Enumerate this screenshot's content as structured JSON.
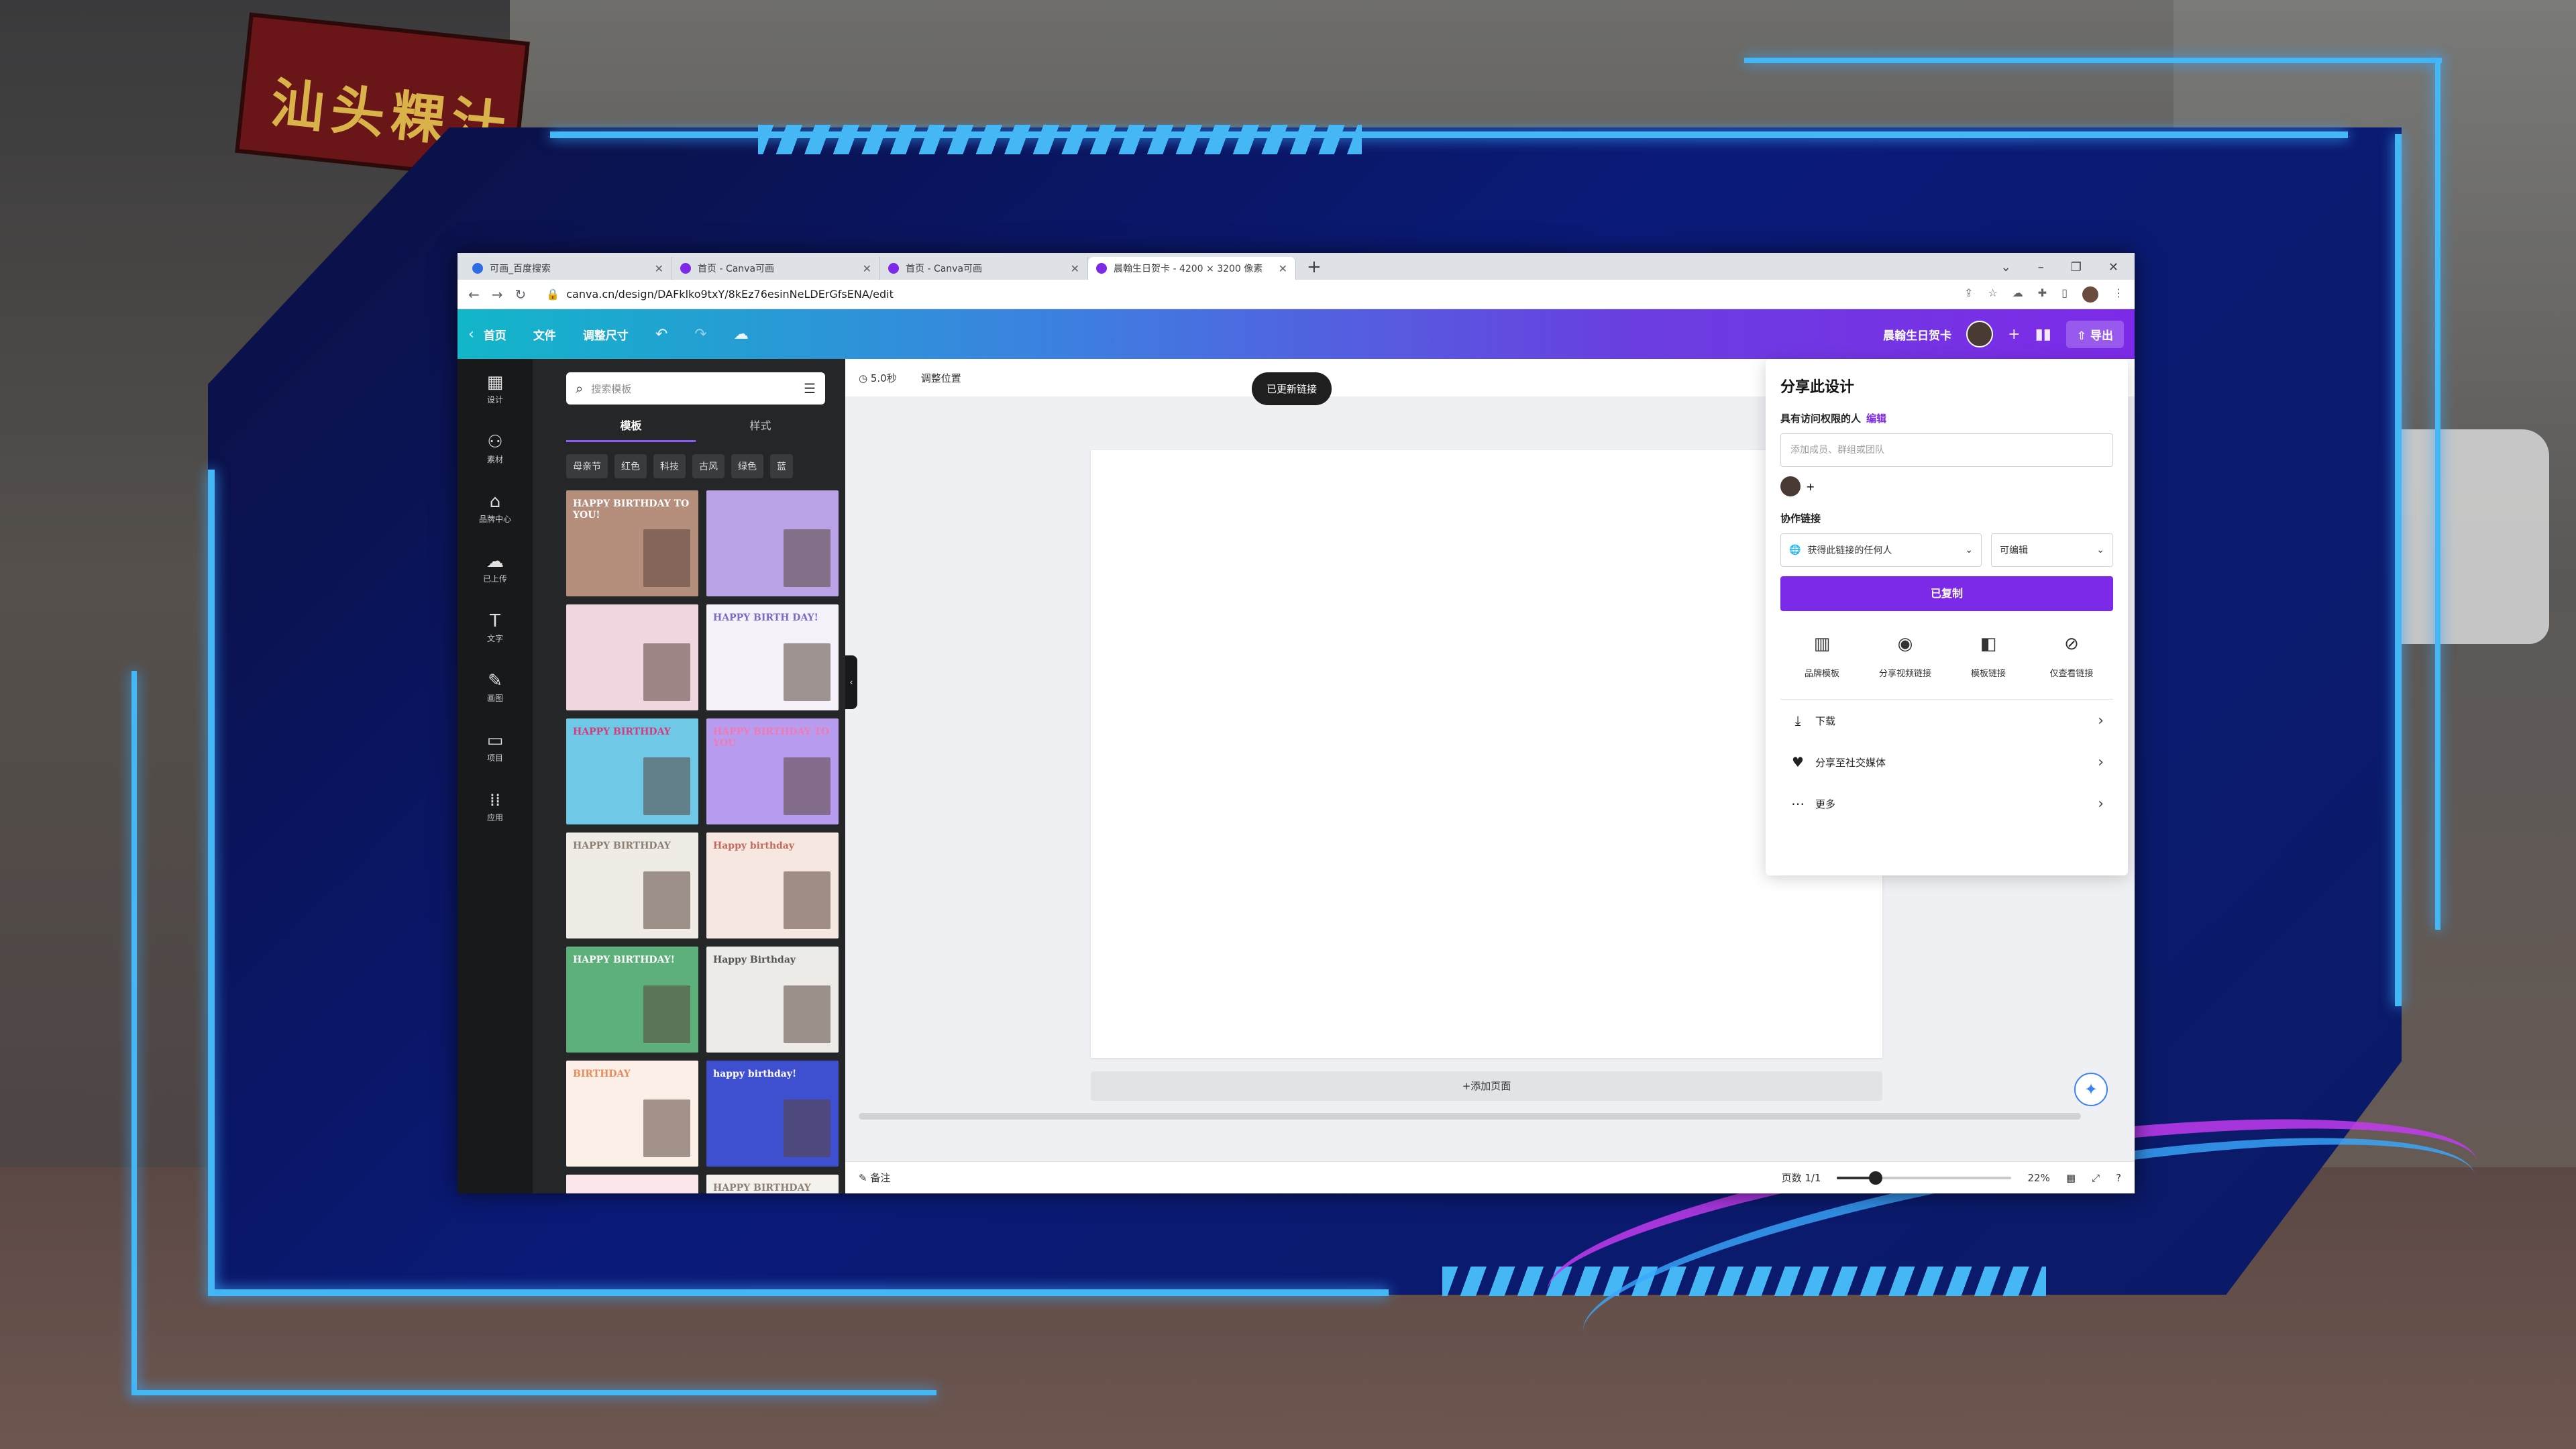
{
  "background": {
    "sign_text": "汕头粿汁"
  },
  "browser": {
    "tabs": [
      {
        "title": "可画_百度搜索",
        "active": false,
        "icon": "baidu"
      },
      {
        "title": "首页 - Canva可画",
        "active": false,
        "icon": "canva"
      },
      {
        "title": "首页 - Canva可画",
        "active": false,
        "icon": "canva"
      },
      {
        "title": "晨翰生日贺卡 - 4200 × 3200 像素",
        "active": true,
        "icon": "canva"
      }
    ],
    "url": "canva.cn/design/DAFklko9txY/8kEz76esinNeLDErGfsENA/edit"
  },
  "header": {
    "home": "首页",
    "file": "文件",
    "resize": "调整尺寸",
    "doc_name": "晨翰生日贺卡",
    "export": "导出"
  },
  "rail": [
    {
      "icon": "▦",
      "label": "设计"
    },
    {
      "icon": "⚇",
      "label": "素材"
    },
    {
      "icon": "⌂",
      "label": "品牌中心"
    },
    {
      "icon": "☁",
      "label": "已上传"
    },
    {
      "icon": "T",
      "label": "文字"
    },
    {
      "icon": "✎",
      "label": "画图"
    },
    {
      "icon": "▭",
      "label": "项目"
    },
    {
      "icon": "⁞⁞",
      "label": "应用"
    }
  ],
  "panel": {
    "search_placeholder": "搜索模板",
    "tab_templates": "模板",
    "tab_styles": "样式",
    "chips": [
      "母亲节",
      "红色",
      "科技",
      "古风",
      "绿色",
      "蓝"
    ],
    "cards": [
      {
        "text": "HAPPY BIRTHDAY TO YOU!",
        "bg": "#b58f7c",
        "fg": "#ffffff"
      },
      {
        "text": "",
        "bg": "#b9a3e6",
        "fg": "#ffffff"
      },
      {
        "text": "",
        "bg": "#f2d6df",
        "fg": "#9c3b5a"
      },
      {
        "text": "HAPPY BIRTH DAY!",
        "bg": "#f4f1f8",
        "fg": "#7b68c9"
      },
      {
        "text": "HAPPY BIRTHDAY",
        "bg": "#6ec8e6",
        "fg": "#d63a7a"
      },
      {
        "text": "HAPPY BIRTHDAY TO YOU",
        "bg": "#b89cf0",
        "fg": "#f27ab2"
      },
      {
        "text": "HAPPY BIRTHDAY",
        "bg": "#efece6",
        "fg": "#8a7f72"
      },
      {
        "text": "Happy birthday",
        "bg": "#f6e7e0",
        "fg": "#c46b5c"
      },
      {
        "text": "HAPPY BIRTHDAY!",
        "bg": "#5eb07a",
        "fg": "#ffffff"
      },
      {
        "text": "Happy Birthday",
        "bg": "#ecebe8",
        "fg": "#555555"
      },
      {
        "text": "BIRTHDAY",
        "bg": "#fbefe8",
        "fg": "#e88a5a"
      },
      {
        "text": "happy birthday!",
        "bg": "#3e4fd0",
        "fg": "#ffffff"
      },
      {
        "text": "",
        "bg": "#fbe6ec",
        "fg": "#c46b5c"
      },
      {
        "text": "HAPPY BIRTHDAY",
        "bg": "#f5f2ee",
        "fg": "#8a7f72"
      }
    ]
  },
  "canvas": {
    "duration": "5.0秒",
    "position": "调整位置",
    "toast": "已更新链接",
    "add_page": "+添加页面",
    "notes": "备注",
    "page_counter": "页数 1/1",
    "zoom_label": "22%",
    "zoom_fraction": 0.22
  },
  "share": {
    "title": "分享此设计",
    "access_label": "具有访问权限的人",
    "edit_link": "编辑",
    "invite_placeholder": "添加成员、群组或团队",
    "collab_label": "协作链接",
    "link_scope": "获得此链接的任何人",
    "link_permission": "可编辑",
    "copied_button": "已复制",
    "options": [
      {
        "icon": "▥",
        "label": "品牌模板"
      },
      {
        "icon": "◉",
        "label": "分享视频链接"
      },
      {
        "icon": "◧",
        "label": "模板链接"
      },
      {
        "icon": "⊘",
        "label": "仅查看链接"
      }
    ],
    "rows": [
      {
        "icon": "⤓",
        "label": "下载"
      },
      {
        "icon": "♥",
        "label": "分享至社交媒体"
      },
      {
        "icon": "⋯",
        "label": "更多"
      }
    ]
  }
}
